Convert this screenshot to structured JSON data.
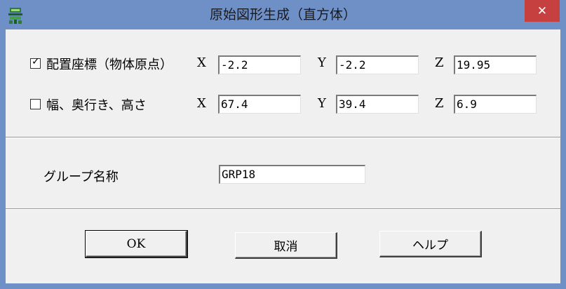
{
  "window": {
    "title": "原始図形生成（直方体）",
    "close_glyph": "✕"
  },
  "position": {
    "checked": true,
    "check_glyph": "✓",
    "label": "配置座標（物体原点）",
    "x_label": "X",
    "x_value": "-2.2",
    "y_label": "Y",
    "y_value": "-2.2",
    "z_label": "Z",
    "z_value": "19.95"
  },
  "size": {
    "checked": false,
    "label": "幅、奥行き、高さ",
    "x_label": "X",
    "x_value": "67.4",
    "y_label": "Y",
    "y_value": "39.4",
    "z_label": "Z",
    "z_value": "6.9"
  },
  "group": {
    "label": "グループ名称",
    "value": "GRP18"
  },
  "buttons": {
    "ok": "OK",
    "cancel": "取消",
    "help": "ヘルプ"
  },
  "colors": {
    "frame": "#6f8fc7",
    "close": "#c74040",
    "client": "#f0f0f0"
  }
}
